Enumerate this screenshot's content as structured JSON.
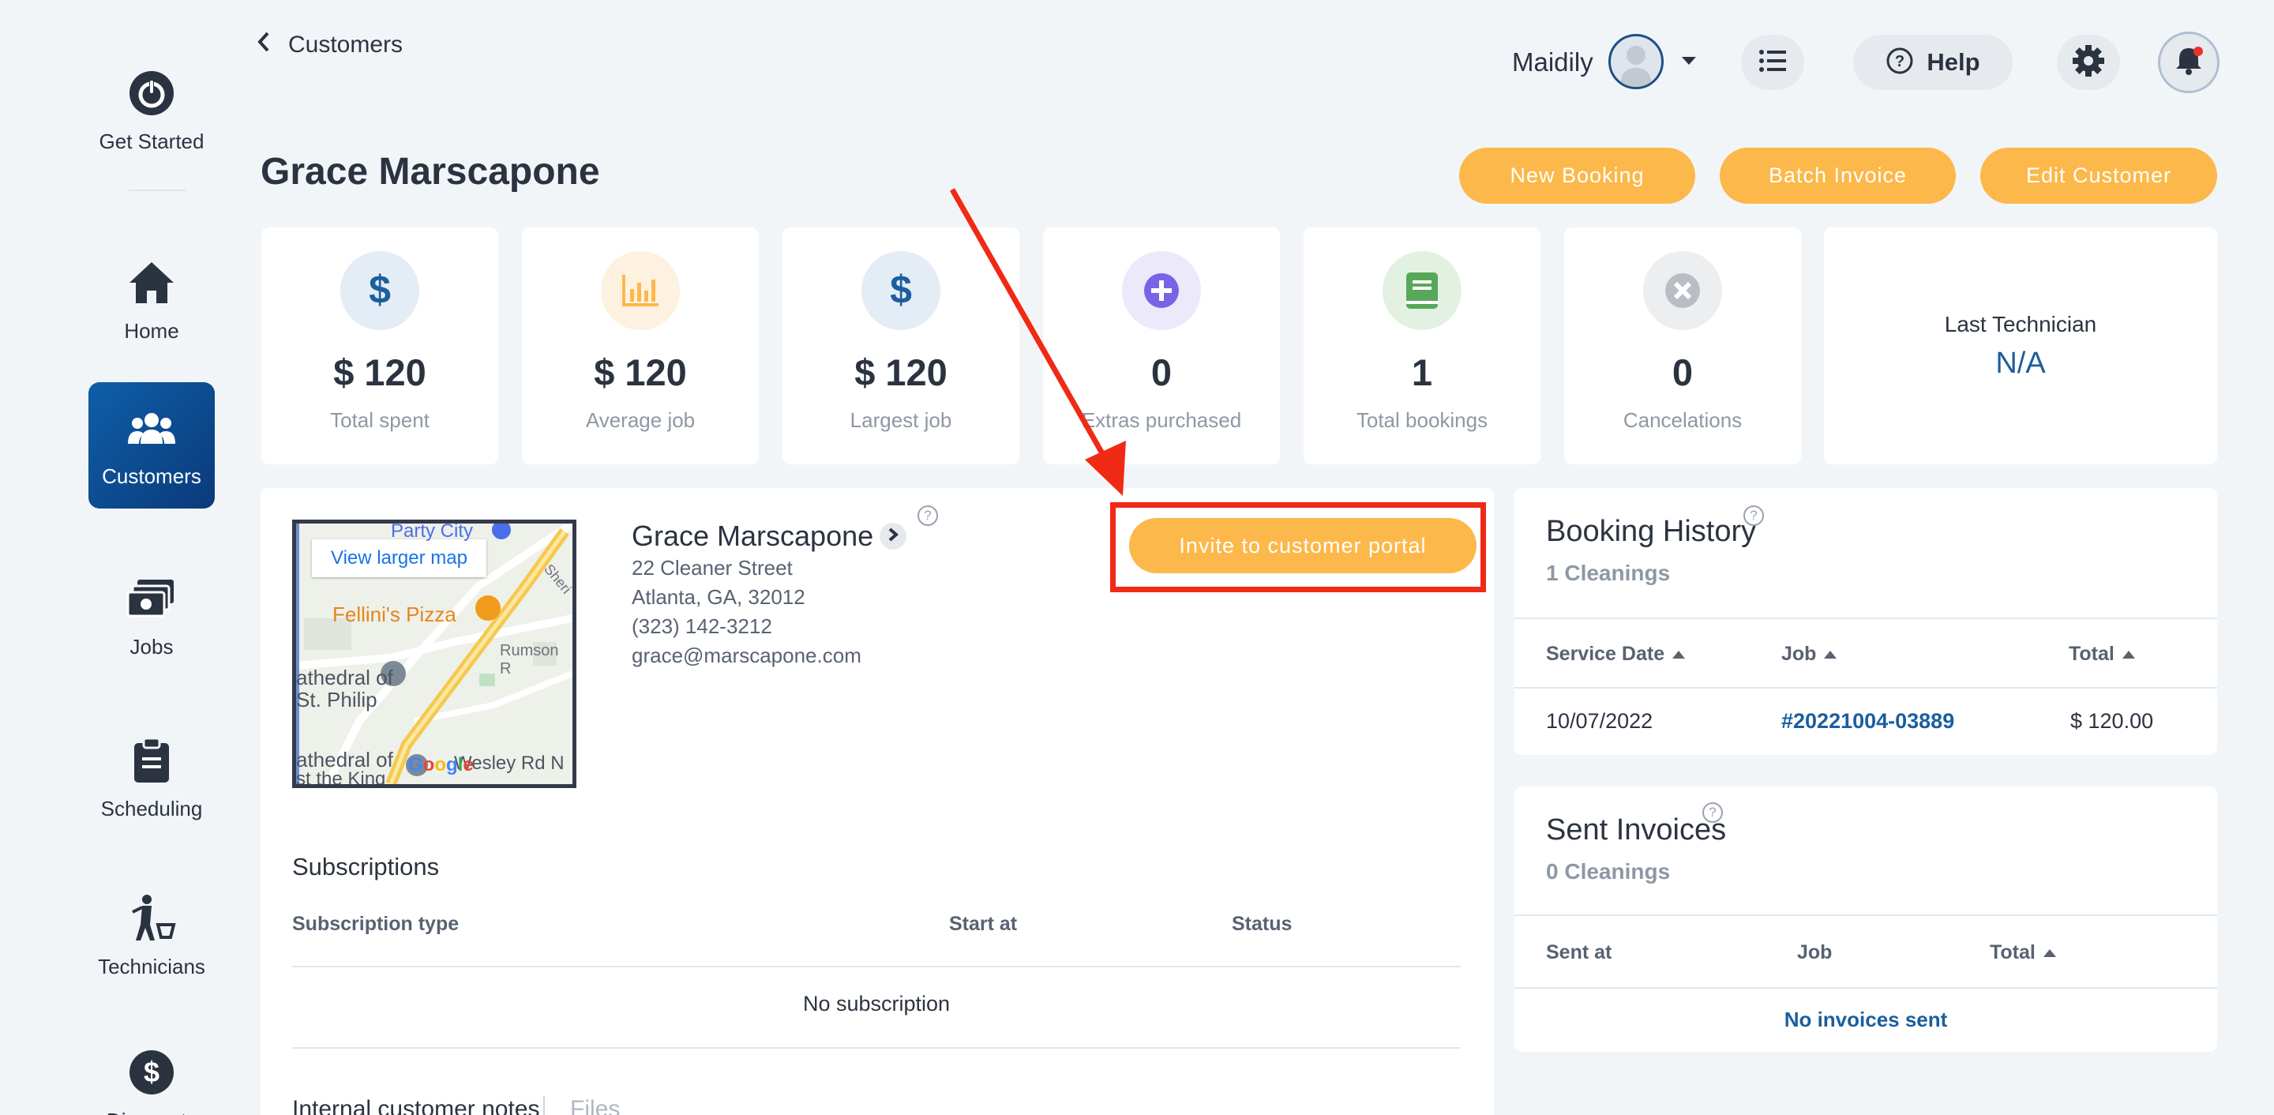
{
  "sidebar": {
    "items": [
      {
        "label": "Get Started",
        "icon": "power-icon"
      },
      {
        "label": "Home",
        "icon": "home-icon"
      },
      {
        "label": "Customers",
        "icon": "users-icon"
      },
      {
        "label": "Jobs",
        "icon": "money-icon"
      },
      {
        "label": "Scheduling",
        "icon": "clipboard-icon"
      },
      {
        "label": "Technicians",
        "icon": "cleaner-icon"
      },
      {
        "label": "Discounts",
        "icon": "dollar-icon"
      }
    ],
    "active": "Customers"
  },
  "topbar": {
    "breadcrumb": "Customers",
    "user_name": "Maidily",
    "help_label": "Help"
  },
  "page": {
    "title": "Grace Marscapone",
    "actions": {
      "new_booking": "New Booking",
      "batch_invoice": "Batch Invoice",
      "edit_customer": "Edit Customer"
    }
  },
  "stats": [
    {
      "value": "$ 120",
      "label": "Total spent",
      "icon": "dollar-icon",
      "color": "#1c5e9e",
      "bg": "#e4ecf5"
    },
    {
      "value": "$ 120",
      "label": "Average job",
      "icon": "bar-chart-icon",
      "color": "#fcb84a",
      "bg": "#fdf1e0"
    },
    {
      "value": "$ 120",
      "label": "Largest job",
      "icon": "dollar-icon",
      "color": "#1c5e9e",
      "bg": "#e4ecf5"
    },
    {
      "value": "0",
      "label": "Extras purchased",
      "icon": "plus-circle-icon",
      "color": "#7a63e6",
      "bg": "#ece9fb"
    },
    {
      "value": "1",
      "label": "Total bookings",
      "icon": "book-icon",
      "color": "#58a85a",
      "bg": "#e3f1e3"
    },
    {
      "value": "0",
      "label": "Cancelations",
      "icon": "x-circle-icon",
      "color": "#b9bec5",
      "bg": "#eceef0"
    }
  ],
  "last_technician": {
    "title": "Last Technician",
    "value": "N/A"
  },
  "customer": {
    "name": "Grace Marscapone",
    "address1": "22 Cleaner Street",
    "address2": "Atlanta, GA, 32012",
    "phone": "(323) 142-3212",
    "email": "grace@marscapone.com",
    "invite_label": "Invite to customer portal"
  },
  "map": {
    "link": "View larger map",
    "places": [
      "Party City",
      "Fellini's Pizza",
      "athedral of",
      "St. Philip",
      "athedral of",
      "st the King",
      "Rumson R",
      "Sheri",
      "Wesley Rd N"
    ],
    "google_letters": [
      "G",
      "o",
      "o",
      "g",
      "l",
      "e"
    ]
  },
  "subscriptions": {
    "title": "Subscriptions",
    "columns": [
      "Subscription type",
      "Start at",
      "Status"
    ],
    "empty": "No subscription"
  },
  "notes_tabs": [
    "Internal customer notes",
    "Files"
  ],
  "booking_history": {
    "title": "Booking History",
    "subtitle": "1 Cleanings",
    "columns": [
      "Service Date",
      "Job",
      "Total"
    ],
    "rows": [
      {
        "date": "10/07/2022",
        "job": "#20221004-03889",
        "total": "$ 120.00"
      }
    ]
  },
  "sent_invoices": {
    "title": "Sent Invoices",
    "subtitle": "0 Cleanings",
    "columns": [
      "Sent at",
      "Job",
      "Total"
    ],
    "empty": "No invoices sent"
  },
  "colors": {
    "accent": "#fcb84a",
    "primary": "#1c5e9e",
    "annotation": "#f02a14"
  }
}
